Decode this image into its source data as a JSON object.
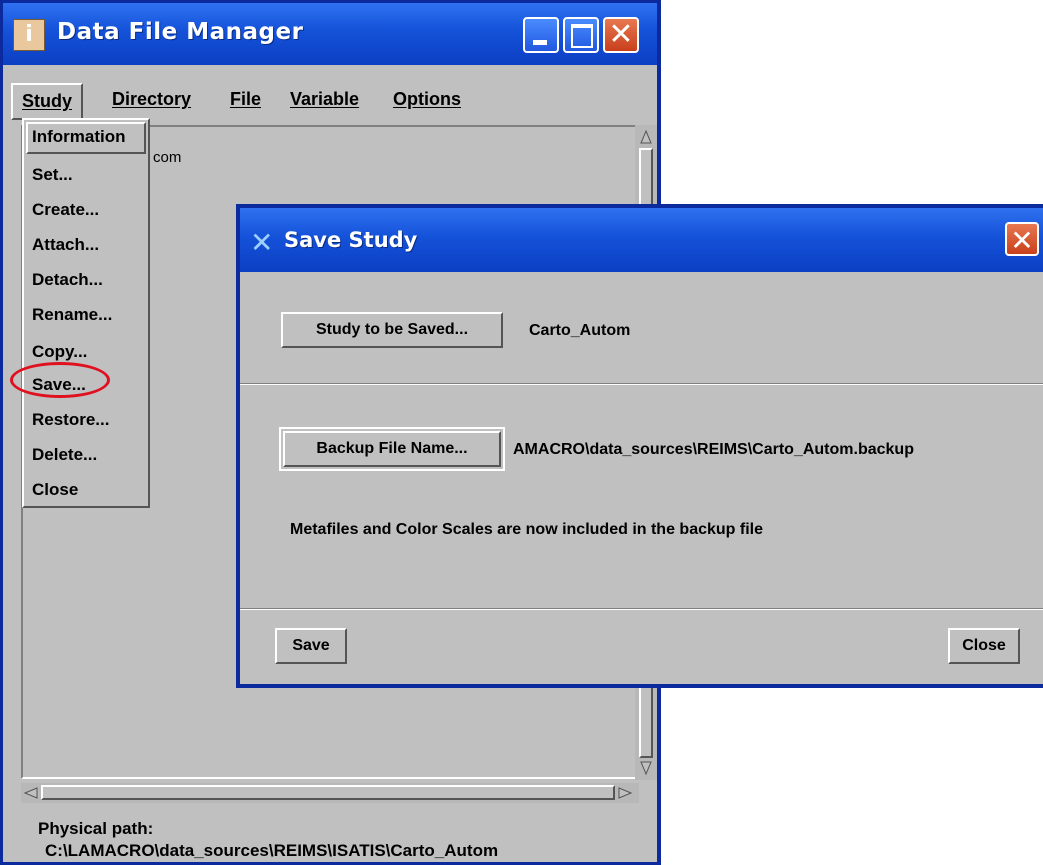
{
  "main_window": {
    "title": "Data File Manager",
    "menus": [
      "Study",
      "Directory",
      "File",
      "Variable",
      "Options"
    ],
    "list_text": "com",
    "physical_path_label": "Physical path:",
    "physical_path": "C:\\LAMACRO\\data_sources\\REIMS\\ISATIS\\Carto_Autom"
  },
  "study_menu": {
    "items": [
      "Information",
      "Set...",
      "Create...",
      "Attach...",
      "Detach...",
      "Rename...",
      "Copy...",
      "Save...",
      "Restore...",
      "Delete...",
      "Close"
    ]
  },
  "dialog": {
    "title": "Save Study",
    "study_button": "Study to be Saved...",
    "study_value": "Carto_Autom",
    "backup_button": "Backup File Name...",
    "backup_value": "AMACRO\\data_sources\\REIMS\\Carto_Autom.backup",
    "note": "Metafiles and Color Scales are now included in the backup file",
    "save_button": "Save",
    "close_button": "Close"
  },
  "colors": {
    "titlebar": "#1452d9",
    "highlight_circle": "#e0101e",
    "window_bg": "#c0c0c0"
  },
  "icons": {
    "app": "info-icon",
    "dialog": "x-logo-icon"
  }
}
